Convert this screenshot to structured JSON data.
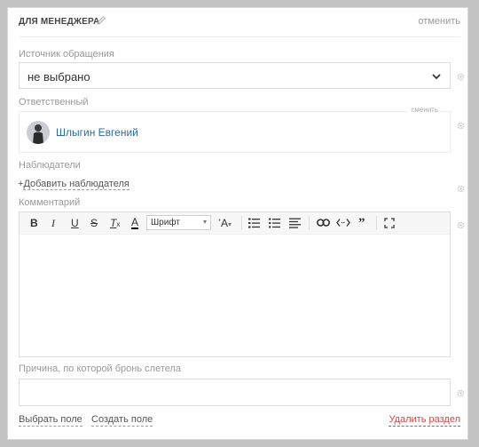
{
  "header": {
    "title": "ДЛЯ МЕНЕДЖЕРА",
    "cancel_label": "отменить"
  },
  "source": {
    "label": "Источник обращения",
    "value": "не выбрано"
  },
  "responsible": {
    "label": "Ответственный",
    "change_label": "сменить",
    "name": "Шлыгин Евгений"
  },
  "observers": {
    "label": "Наблюдатели",
    "add_prefix": "+",
    "add_label": "Добавить наблюдателя"
  },
  "comment": {
    "label": "Комментарий",
    "toolbar": {
      "bold": "B",
      "italic": "I",
      "underline": "U",
      "strike": "S",
      "clear_format": "T",
      "clear_format_sub": "x",
      "text_color": "A",
      "font_value": "Шрифт",
      "font_size": "A"
    }
  },
  "reason": {
    "label": "Причина, по которой бронь слетела",
    "value": ""
  },
  "footer": {
    "select_field": "Выбрать поле",
    "create_field": "Создать поле",
    "delete_section": "Удалить раздел"
  },
  "colors": {
    "link_blue": "#2d6aa3",
    "danger": "#d64545",
    "background": "#c4c4c4"
  },
  "icons": [
    "pencil-icon",
    "chevron-down-icon",
    "gear-icon",
    "link-icon",
    "code-icon",
    "quote-icon",
    "fullscreen-icon",
    "ordered-list-icon",
    "bullet-list-icon",
    "align-icon"
  ]
}
